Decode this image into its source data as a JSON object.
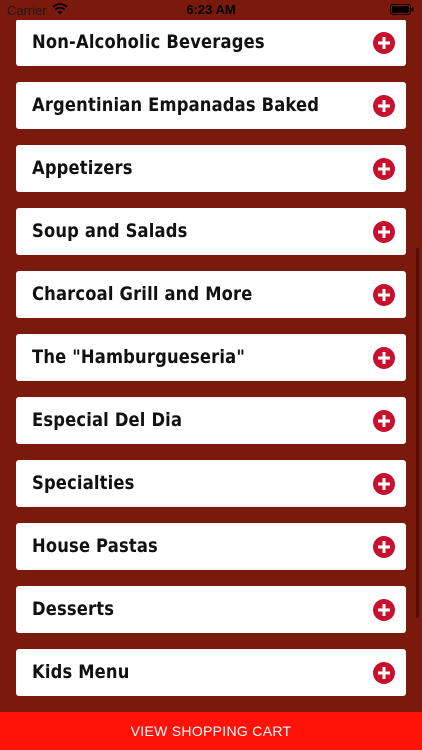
{
  "status_bar": {
    "carrier": "Carrier",
    "time": "6:23 AM"
  },
  "menu": {
    "categories": [
      {
        "label": "Non-Alcoholic Beverages"
      },
      {
        "label": "Argentinian Empanadas Baked"
      },
      {
        "label": "Appetizers"
      },
      {
        "label": "Soup and Salads"
      },
      {
        "label": "Charcoal Grill and More"
      },
      {
        "label": "The \"Hamburgueseria\""
      },
      {
        "label": "Especial Del Dia"
      },
      {
        "label": "Specialties"
      },
      {
        "label": "House Pastas"
      },
      {
        "label": "Desserts"
      },
      {
        "label": "Kids Menu"
      }
    ],
    "expand_icon": "plus-circle-icon"
  },
  "cart": {
    "label": "VIEW SHOPPING CART"
  },
  "colors": {
    "background": "#7a1a0c",
    "card": "#ffffff",
    "accent": "#c8102e",
    "cart_bar": "#ff1208"
  }
}
